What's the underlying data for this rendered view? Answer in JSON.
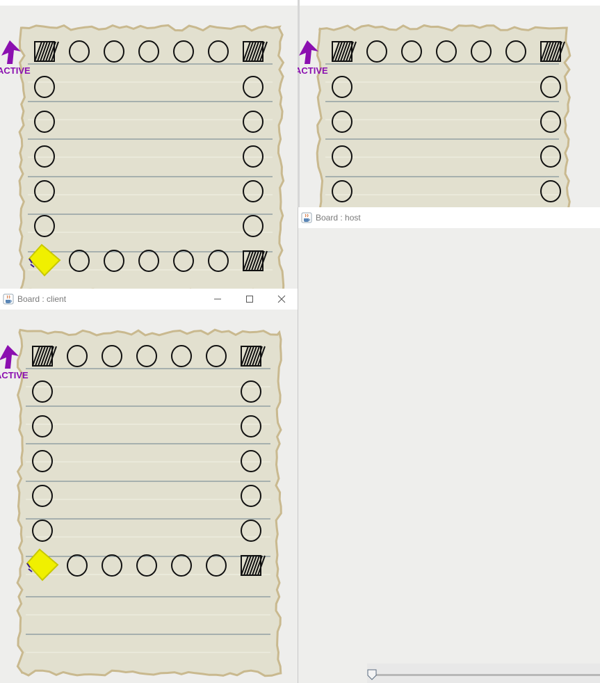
{
  "windows": {
    "client": {
      "title": "Board : client"
    },
    "host": {
      "title": "Board : host"
    }
  },
  "board": {
    "active_label": "ACTIVE",
    "active_color": "#8b10b0",
    "player_token_color": "#f0f000",
    "paper_color": "#e2e0cf",
    "line_color": "#6a7f8c"
  },
  "icons": {
    "app": "java-cup-icon",
    "minimize": "minimize-icon",
    "maximize": "maximize-icon",
    "close": "close-icon",
    "active_marker": "active-arrow-icon",
    "corner": "scribbled-square-icon",
    "space": "circle-space-icon",
    "token": "yellow-player-token-icon"
  }
}
